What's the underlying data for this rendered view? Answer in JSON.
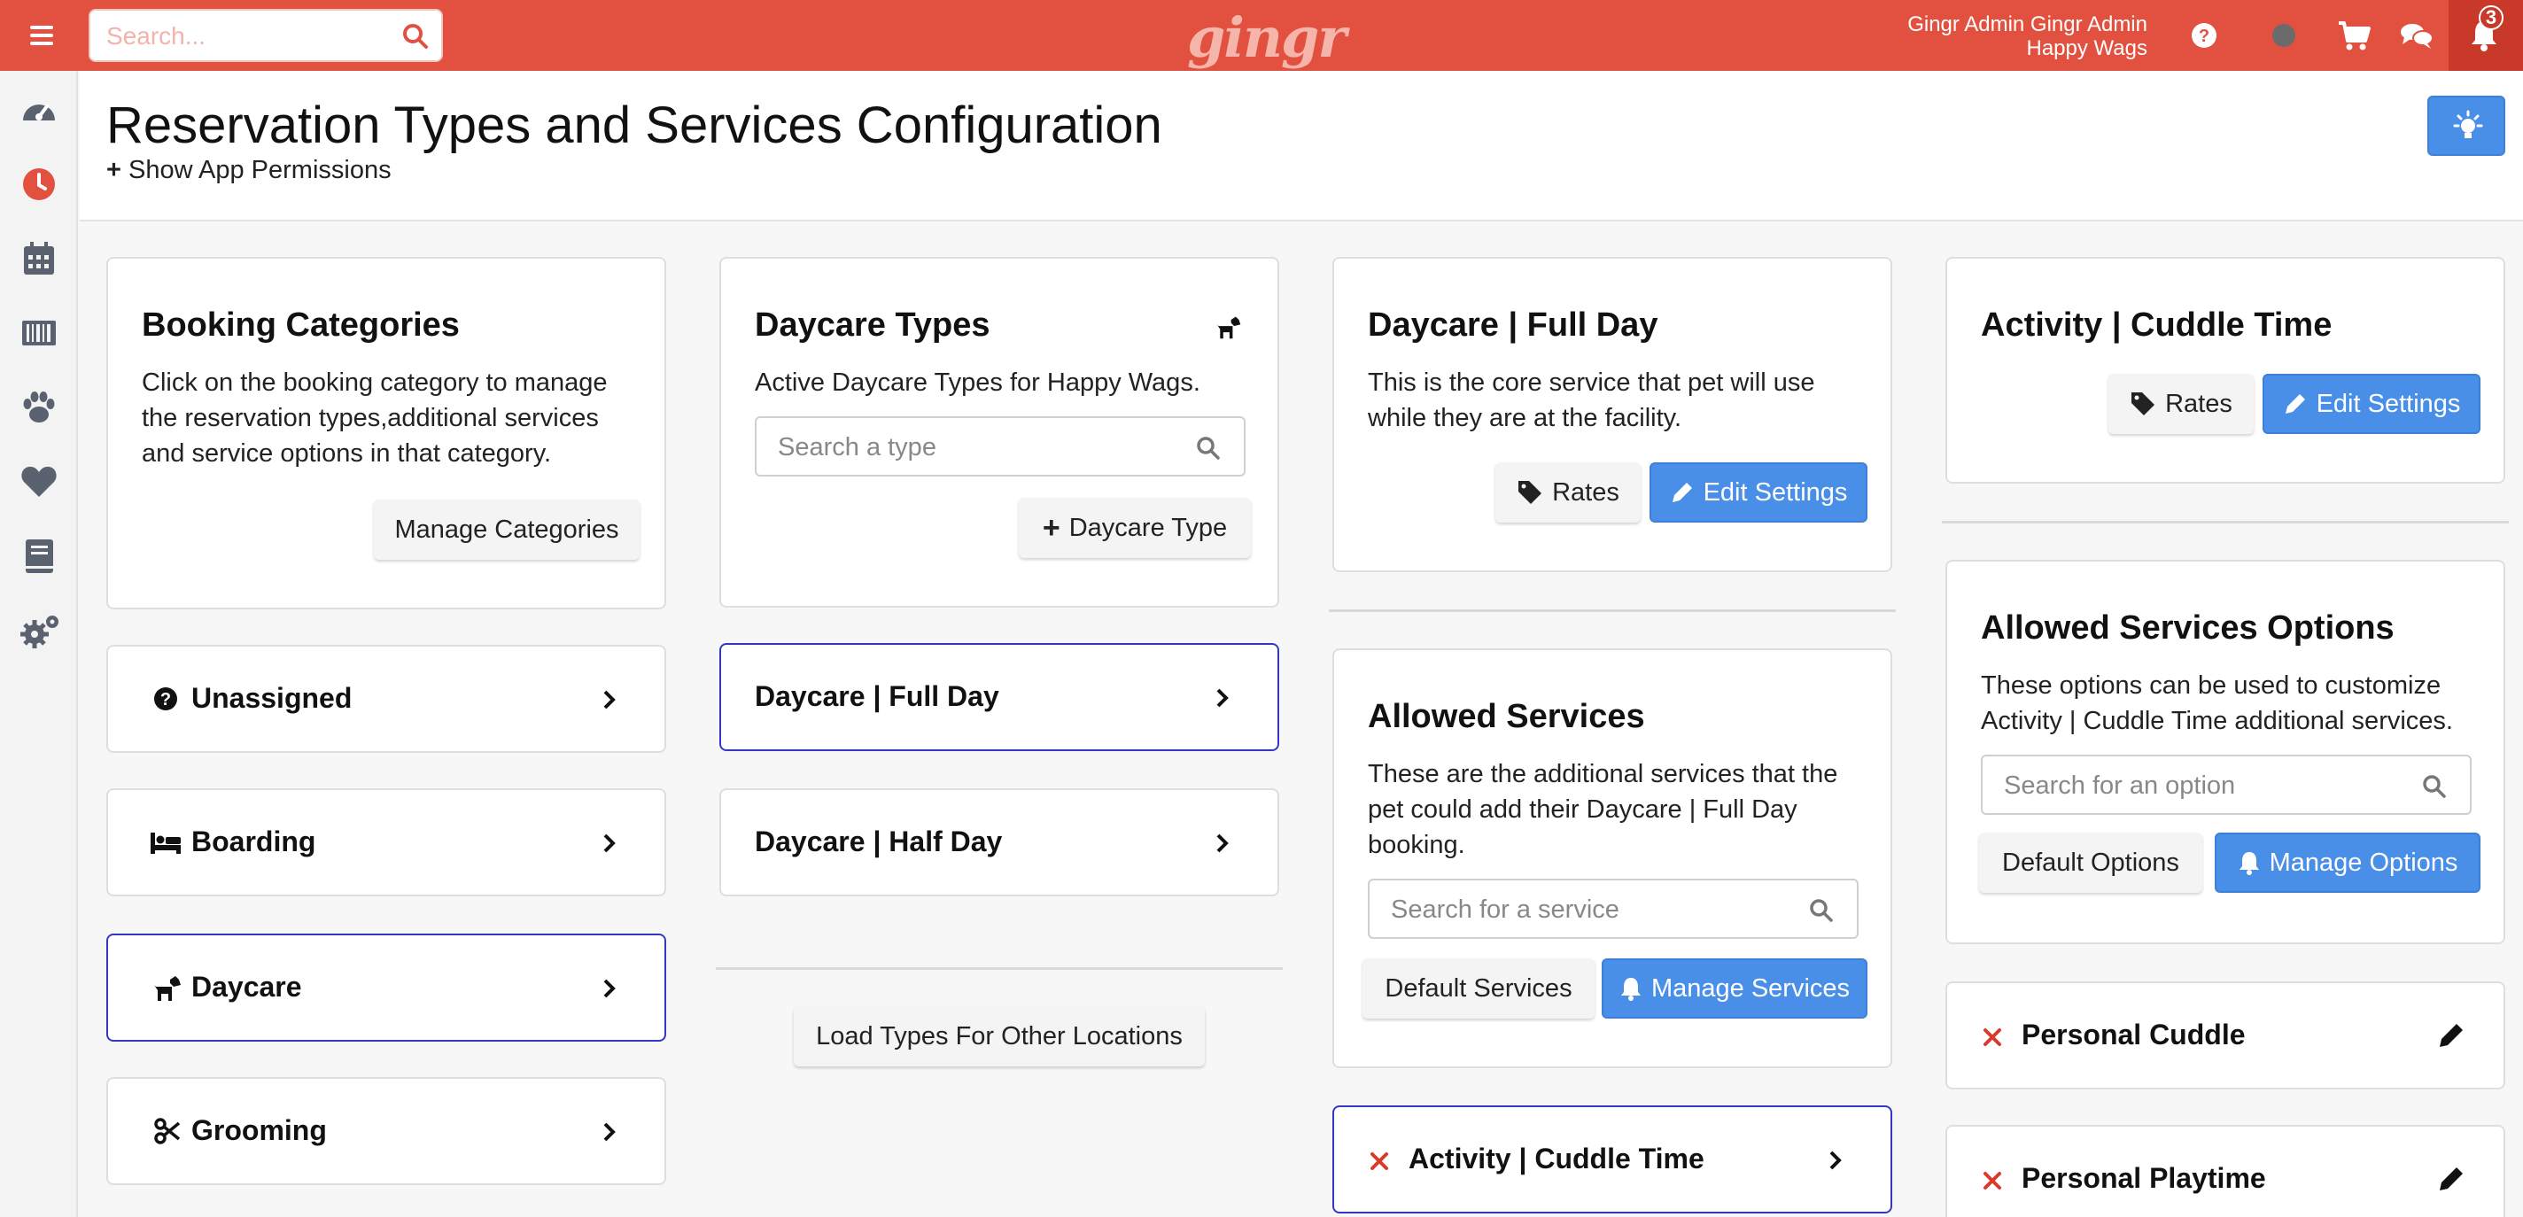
{
  "topbar": {
    "search_placeholder": "Search...",
    "logo": "gingr",
    "user_name": "Gingr Admin Gingr Admin",
    "location": "Happy Wags",
    "notifications_count": "3",
    "colors": {
      "bar": "#e2503f",
      "primary": "#4a8fe7"
    }
  },
  "sidebar": {
    "items": [
      {
        "icon": "dashboard-icon"
      },
      {
        "icon": "clock-icon"
      },
      {
        "icon": "calendar-icon"
      },
      {
        "icon": "barcode-icon"
      },
      {
        "icon": "paw-icon"
      },
      {
        "icon": "heart-icon"
      },
      {
        "icon": "book-icon"
      },
      {
        "icon": "gears-icon"
      }
    ]
  },
  "header": {
    "title": "Reservation Types and Services Configuration",
    "permissions_toggle": "Show App Permissions"
  },
  "booking_categories": {
    "title": "Booking Categories",
    "description": "Click on the booking category to manage the reservation types,additional services and service options in that category.",
    "manage_button": "Manage Categories",
    "items": [
      {
        "label": "Unassigned",
        "icon": "question-circle-icon"
      },
      {
        "label": "Boarding",
        "icon": "bed-icon"
      },
      {
        "label": "Daycare",
        "icon": "dog-icon",
        "selected": true
      },
      {
        "label": "Grooming",
        "icon": "scissors-icon"
      }
    ]
  },
  "daycare_types": {
    "title": "Daycare Types",
    "description": "Active Daycare Types for Happy Wags.",
    "search_placeholder": "Search a type",
    "add_button": "Daycare Type",
    "items": [
      {
        "label": "Daycare | Full Day",
        "selected": true
      },
      {
        "label": "Daycare | Half Day"
      }
    ],
    "load_other_button": "Load Types For Other Locations"
  },
  "daycare_full_day": {
    "title": "Daycare | Full Day",
    "description": "This is the core service that pet will use while they are at the facility.",
    "rates_button": "Rates",
    "edit_button": "Edit Settings"
  },
  "allowed_services": {
    "title": "Allowed Services",
    "description": "These are the additional services that the pet could add their Daycare | Full Day booking.",
    "search_placeholder": "Search for a service",
    "default_button": "Default Services",
    "manage_button": "Manage Services",
    "items": [
      {
        "label": "Activity | Cuddle Time",
        "selected": true
      }
    ]
  },
  "activity_cuddle_time": {
    "title": "Activity | Cuddle Time",
    "rates_button": "Rates",
    "edit_button": "Edit Settings"
  },
  "allowed_service_options": {
    "title": "Allowed Services Options",
    "description": "These options can be used to customize Activity | Cuddle Time additional services.",
    "search_placeholder": "Search for an option",
    "default_button": "Default Options",
    "manage_button": "Manage Options",
    "items": [
      {
        "label": "Personal Cuddle"
      },
      {
        "label": "Personal Playtime"
      }
    ]
  }
}
